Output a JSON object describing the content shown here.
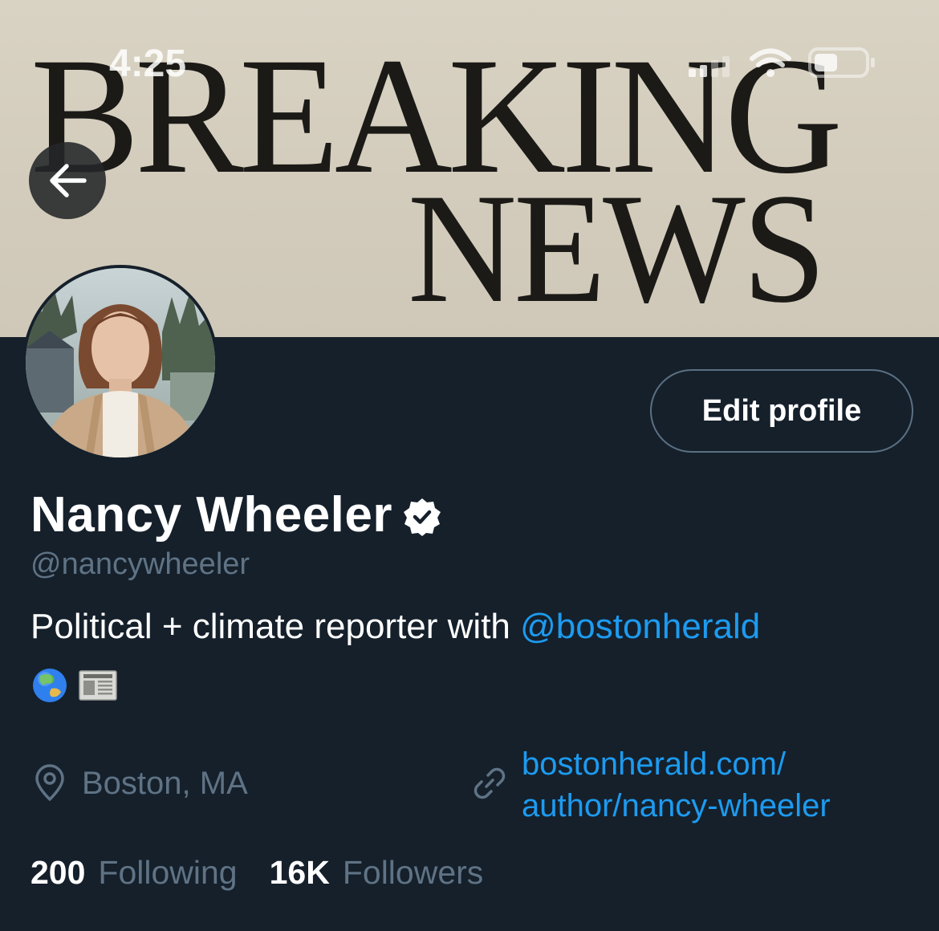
{
  "status_bar": {
    "time": "4:25",
    "icons": [
      "signal-icon",
      "wifi-icon",
      "battery-icon"
    ]
  },
  "banner": {
    "headline_line1": "BREAKING",
    "headline_line2": "NEWS"
  },
  "navigation": {
    "back_icon": "arrow-left-icon"
  },
  "profile": {
    "display_name": "Nancy Wheeler",
    "verified": true,
    "handle": "@nancywheeler",
    "bio_text": "Political + climate reporter with ",
    "bio_mention": "@bostonherald",
    "bio_emojis": [
      "globe-asia-australia-emoji",
      "newspaper-emoji"
    ],
    "location": "Boston, MA",
    "website_line1": "bostonherald.com/",
    "website_line2": "author/nancy-wheeler",
    "following_count": "200",
    "following_label": "Following",
    "followers_count": "16K",
    "followers_label": "Followers"
  },
  "actions": {
    "edit_profile_label": "Edit profile"
  },
  "colors": {
    "background": "#15202b",
    "accent": "#1d9bf0",
    "secondary_text": "#5f7385",
    "border": "#5b7083"
  }
}
